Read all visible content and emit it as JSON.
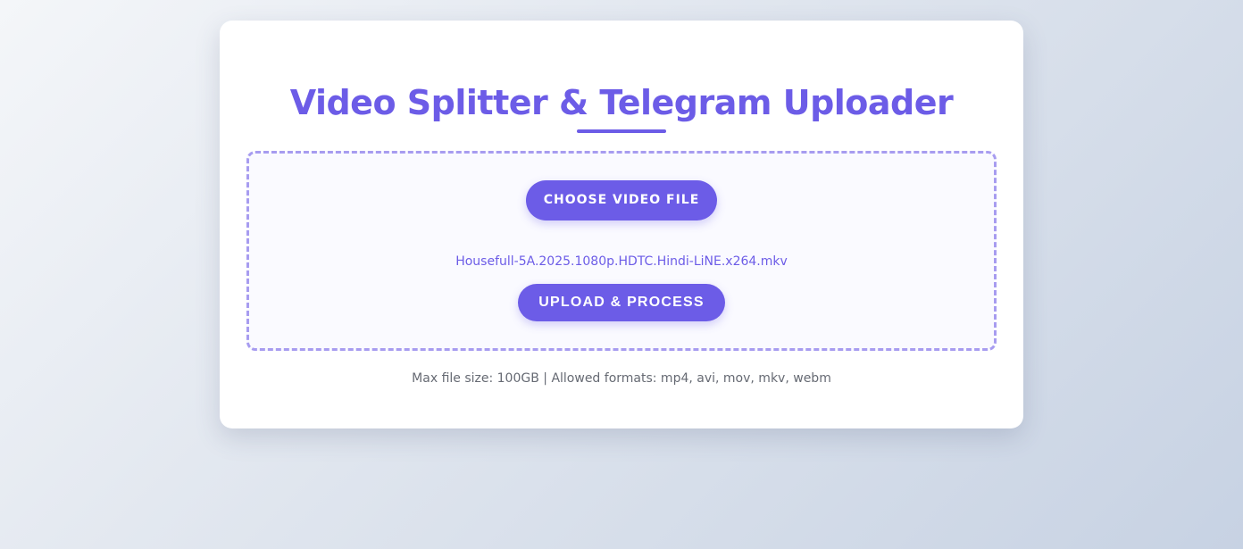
{
  "page": {
    "title": "Video Splitter & Telegram Uploader"
  },
  "upload": {
    "choose_button_label": "CHOOSE VIDEO FILE",
    "selected_file_name": "Housefull-5A.2025.1080p.HDTC.Hindi-LiNE.x264.mkv",
    "upload_button_label": "UPLOAD & PROCESS"
  },
  "info": {
    "limits_text": "Max file size: 100GB | Allowed formats: mp4, avi, mov, mkv, webm"
  },
  "colors": {
    "accent": "#6c5ce7",
    "dashed_border": "#a79cf0",
    "info_text": "#666a73",
    "card_background": "#ffffff"
  }
}
